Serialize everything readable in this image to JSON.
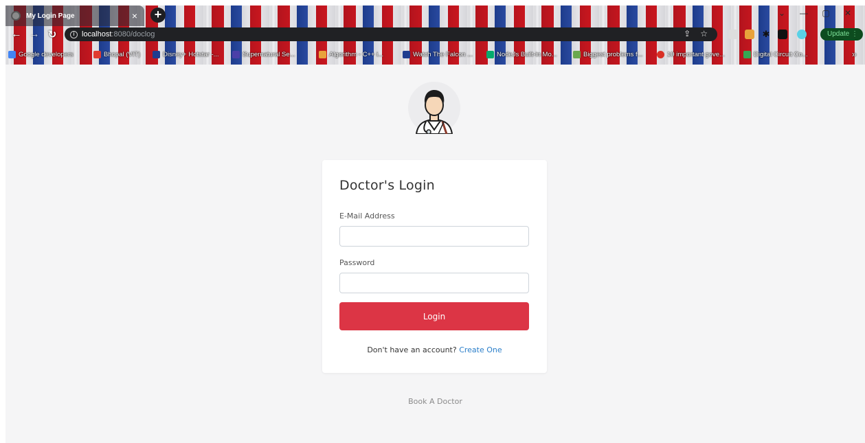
{
  "browser": {
    "tab_title": "My Login Page",
    "tab_close": "×",
    "new_tab": "+",
    "url_host": "localhost",
    "url_path": ":8080/doclog",
    "update_label": "Update",
    "window_controls": [
      "⌄",
      "—",
      "▢",
      "✕"
    ],
    "bookmarks": [
      {
        "label": "Google developers",
        "icon": "google-dev-icon",
        "color": "#4285f4"
      },
      {
        "label": "Bhopal (VIT)",
        "icon": "vit-icon",
        "color": "#e03c31"
      },
      {
        "label": "Disney+ Hotstar -...",
        "icon": "hotstar-icon",
        "color": "#1f3d8f"
      },
      {
        "label": "Supernatural Se...",
        "icon": "supernatural-icon",
        "color": "#4b3fa8"
      },
      {
        "label": "Algorithm - C++ i...",
        "icon": "algorithm-icon",
        "color": "#e9a23b"
      },
      {
        "label": "Watch The Falcon ...",
        "icon": "hotstar-icon",
        "color": "#1f3d8f"
      },
      {
        "label": "NodeJs Built-in Mo...",
        "icon": "w3-icon",
        "color": "#04aa6d"
      },
      {
        "label": "Biggest problems f...",
        "icon": "problems-icon",
        "color": "#6aa84f"
      },
      {
        "label": "10 important gove...",
        "icon": "gov-icon",
        "color": "#d93025"
      },
      {
        "label": "Digital Circuit Co...",
        "icon": "digital-icon",
        "color": "#34a853"
      }
    ]
  },
  "colors": {
    "accent_red": "#dc3545",
    "link_blue": "#2a7ec9",
    "page_bg": "#f5f5f6"
  },
  "login": {
    "title": "Doctor's Login",
    "email_label": "E-Mail Address",
    "email_value": "",
    "password_label": "Password",
    "password_value": "",
    "button_label": "Login",
    "no_account_text": "Don't have an account?",
    "create_link": "Create One"
  },
  "footer": {
    "brand": "Book A Doctor"
  }
}
